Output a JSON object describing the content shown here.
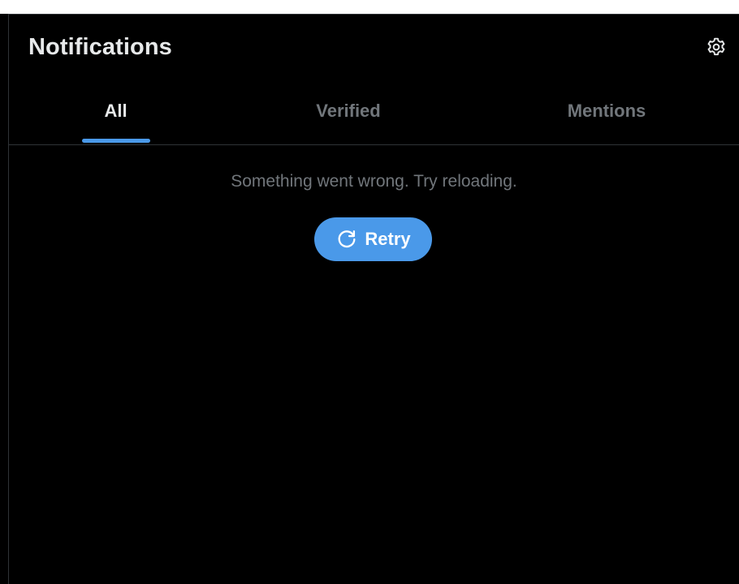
{
  "header": {
    "title": "Notifications",
    "settings_icon": "gear-icon"
  },
  "tabs": [
    {
      "label": "All",
      "active": true
    },
    {
      "label": "Verified",
      "active": false
    },
    {
      "label": "Mentions",
      "active": false
    }
  ],
  "error": {
    "message": "Something went wrong. Try reloading.",
    "retry_label": "Retry",
    "retry_icon": "refresh-icon"
  },
  "colors": {
    "background": "#000000",
    "accent": "#4a99e9",
    "text_primary": "#e7e9ea",
    "text_secondary": "#71767b",
    "border": "#2f3336"
  }
}
